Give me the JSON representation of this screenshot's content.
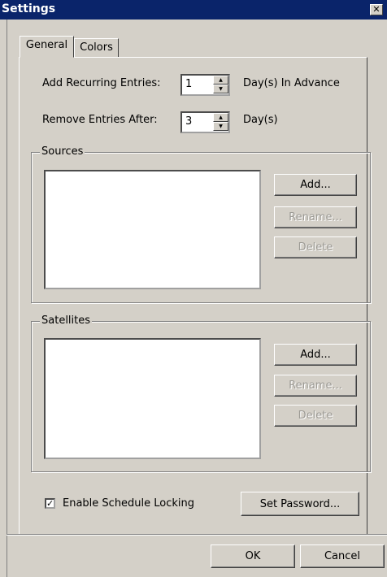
{
  "window": {
    "title": "Settings",
    "close_glyph": "✕"
  },
  "tabs": [
    {
      "label": "General"
    },
    {
      "label": "Colors"
    }
  ],
  "general": {
    "recurring": {
      "label": "Add Recurring Entries:",
      "value": "1",
      "suffix": "Day(s) In Advance"
    },
    "remove": {
      "label": "Remove Entries After:",
      "value": "3",
      "suffix": "Day(s)"
    },
    "sources": {
      "title": "Sources",
      "add": "Add...",
      "rename": "Rename...",
      "delete": "Delete"
    },
    "satellites": {
      "title": "Satellites",
      "add": "Add...",
      "rename": "Rename...",
      "delete": "Delete"
    },
    "locking": {
      "label": "Enable Schedule Locking",
      "checked": true,
      "check_glyph": "✓",
      "set_password": "Set Password..."
    }
  },
  "footer": {
    "ok": "OK",
    "cancel": "Cancel"
  }
}
